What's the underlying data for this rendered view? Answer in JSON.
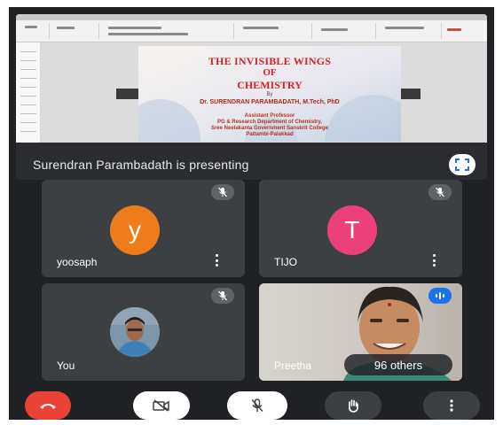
{
  "slide": {
    "title_line1": "THE INVISIBLE WINGS",
    "title_line2": "OF",
    "title_line3": "CHEMISTRY",
    "by": "By",
    "author": "Dr. SURENDRAN PARAMBADATH, M.Tech, PhD",
    "designation": "Assistant Professor",
    "department": "PG & Research Department of Chemistry,",
    "college": "Sree Neelakanta Government Sanskrit College",
    "place": "Pattambi-Palakkad"
  },
  "presentation": {
    "label": "Surendran Parambadath is presenting"
  },
  "participants": [
    {
      "name": "yoosaph",
      "initial": "y",
      "color": "#ef7c1a"
    },
    {
      "name": "TIJO",
      "initial": "T",
      "color": "#ec407a"
    },
    {
      "name": "You"
    },
    {
      "name": "Preetha"
    }
  ],
  "others": {
    "label": "96 others"
  },
  "controls": {
    "end_call_color": "#ea4335",
    "speaking_color": "#1a73e8"
  }
}
